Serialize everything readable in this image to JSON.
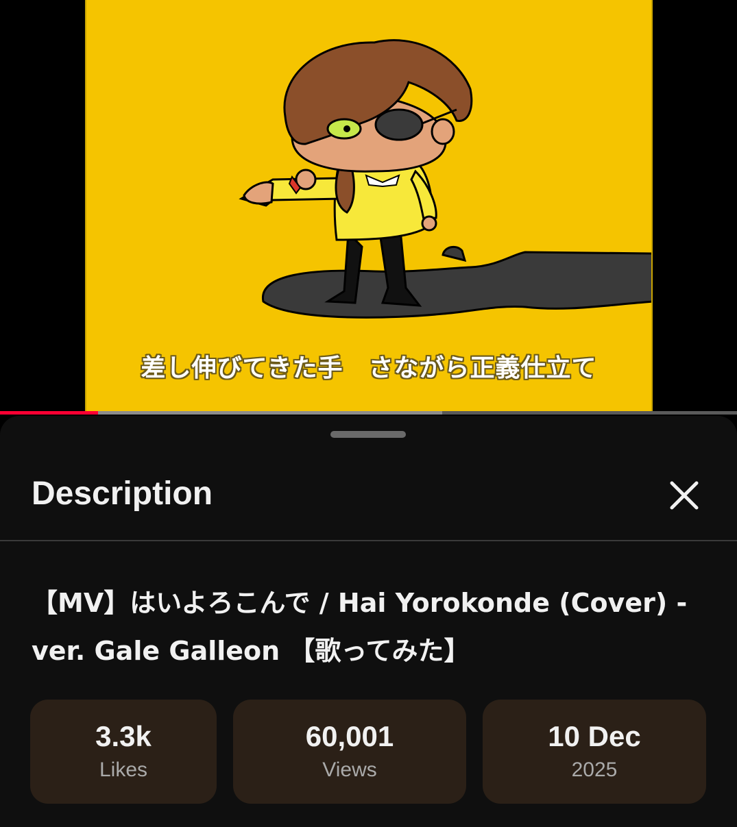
{
  "player": {
    "subtitle": "差し伸びてきた手　さながら正義仕立て",
    "progress_played": 0.133,
    "progress_buffered": 0.6
  },
  "sheet": {
    "title": "Description",
    "close_icon": "close-icon"
  },
  "video": {
    "title": "【MV】はいよろこんで / Hai Yorokonde (Cover) - ver. Gale Galleon 【歌ってみた】"
  },
  "stats": {
    "likes": {
      "value": "3.3k",
      "label": "Likes"
    },
    "views": {
      "value": "60,001",
      "label": "Views"
    },
    "date": {
      "value": "10 Dec",
      "label": "2025"
    }
  },
  "colors": {
    "frame_background": "#f5c400",
    "progress_played": "#ff0033",
    "stat_card": "#2b2017",
    "sheet_background": "#0f0f0f"
  }
}
